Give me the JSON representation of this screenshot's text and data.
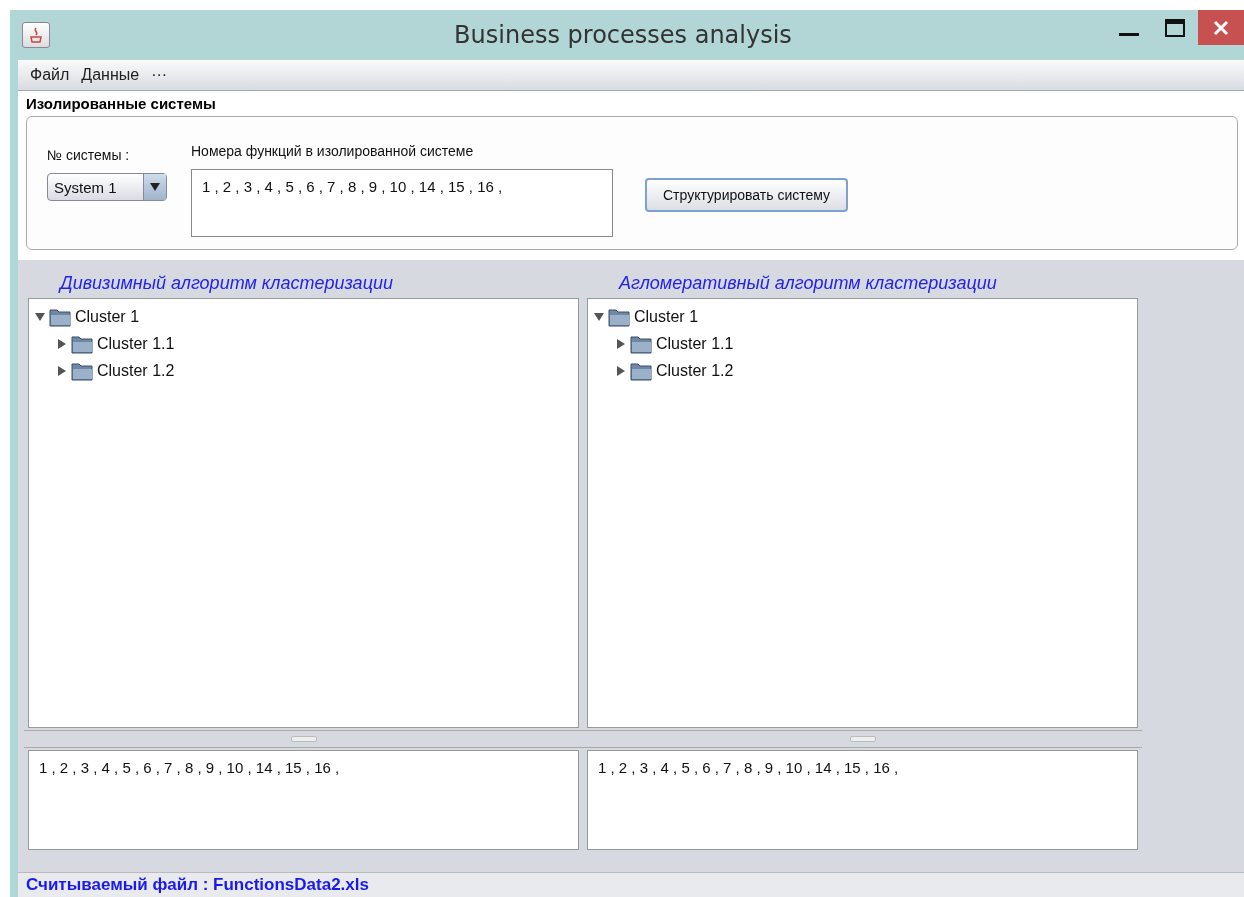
{
  "window": {
    "title": "Business processes analysis"
  },
  "menu": [
    {
      "label": "Файл"
    },
    {
      "label": "Данные"
    },
    {
      "label": "···"
    }
  ],
  "isolated_systems": {
    "title": "Изолированные системы",
    "system_label": "№ системы :",
    "system_value": "System 1",
    "functions_label": "Номера функций в изолированной системе",
    "functions_value": "1 , 2 , 3 , 4 , 5 , 6 , 7 , 8 , 9 , 10 , 14 , 15 , 16 ,",
    "button": "Структурировать систему"
  },
  "panels": [
    {
      "title": "Дивизимный алгоритм кластеризации",
      "tree": [
        {
          "label": "Cluster 1",
          "expanded": true,
          "children": [
            {
              "label": "Cluster 1.1",
              "expanded": false
            },
            {
              "label": "Cluster 1.2",
              "expanded": false
            }
          ]
        }
      ],
      "output": "1 , 2 , 3 , 4 , 5 , 6 , 7 , 8 , 9 , 10 , 14 , 15 , 16 ,"
    },
    {
      "title": "Агломеративный алгоритм кластеризации",
      "tree": [
        {
          "label": "Cluster 1",
          "expanded": true,
          "children": [
            {
              "label": "Cluster 1.1",
              "expanded": false
            },
            {
              "label": "Cluster 1.2",
              "expanded": false
            }
          ]
        }
      ],
      "output": "1 , 2 , 3 , 4 , 5 , 6 , 7 , 8 , 9 , 10 , 14 , 15 , 16 ,"
    }
  ],
  "status_bar": "Считываемый файл : FunctionsData2.xls"
}
